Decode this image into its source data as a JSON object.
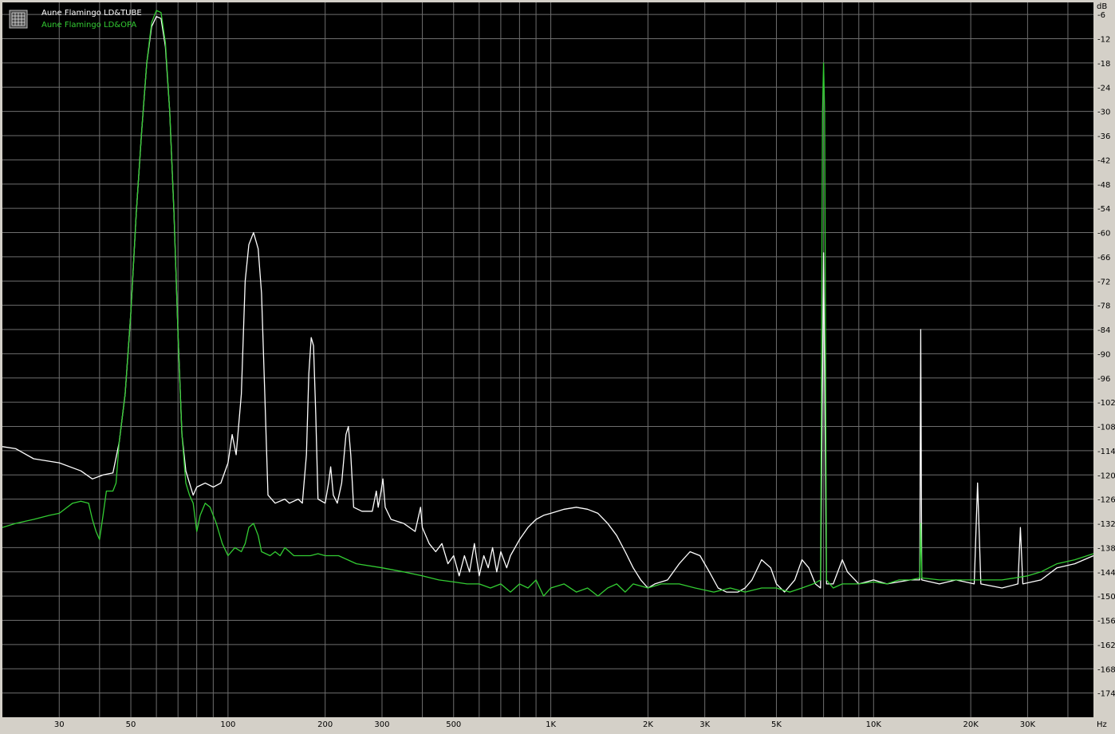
{
  "chart_data": {
    "type": "line",
    "title": "",
    "xlabel": "Hz",
    "ylabel": "dB",
    "x_scale": "log",
    "xlim": [
      20,
      48000
    ],
    "ylim": [
      -180,
      -3
    ],
    "grid": true,
    "legend_position": "top-left",
    "background": "#000000",
    "x_ticks": [
      30,
      50,
      100,
      200,
      300,
      500,
      1000,
      2000,
      3000,
      5000,
      10000,
      20000,
      30000
    ],
    "x_tick_labels": [
      "30",
      "50",
      "100",
      "200",
      "300",
      "500",
      "1K",
      "2K",
      "3K",
      "5K",
      "10K",
      "20K",
      "30K"
    ],
    "y_ticks": [
      -6,
      -12,
      -18,
      -24,
      -30,
      -36,
      -42,
      -48,
      -54,
      -60,
      -66,
      -72,
      -78,
      -84,
      -90,
      -96,
      -102,
      -108,
      -114,
      -120,
      -126,
      -132,
      -138,
      -144,
      -150,
      -156,
      -162,
      -168,
      -174
    ],
    "y_tick_labels": [
      "-6",
      "-12",
      "-18",
      "-24",
      "-30",
      "-36",
      "-42",
      "-48",
      "-54",
      "-60",
      "-66",
      "-72",
      "-78",
      "-84",
      "-90",
      "-96",
      "-102",
      "-108",
      "-114",
      "-120",
      "-126",
      "-132",
      "-138",
      "-144",
      "-150",
      "-156",
      "-162",
      "-168",
      "-174"
    ],
    "series": [
      {
        "name": "Aune Flamingo LD&TUBE",
        "color": "#ffffff",
        "points": [
          [
            20,
            -113
          ],
          [
            22,
            -113.5
          ],
          [
            25,
            -116
          ],
          [
            30,
            -117
          ],
          [
            35,
            -119
          ],
          [
            38,
            -121
          ],
          [
            41,
            -120
          ],
          [
            44,
            -119.5
          ],
          [
            46,
            -112
          ],
          [
            48,
            -100
          ],
          [
            50,
            -80
          ],
          [
            52,
            -55
          ],
          [
            54,
            -35
          ],
          [
            56,
            -18
          ],
          [
            58,
            -9
          ],
          [
            60,
            -6.5
          ],
          [
            62,
            -7
          ],
          [
            64,
            -14
          ],
          [
            66,
            -30
          ],
          [
            68,
            -55
          ],
          [
            70,
            -85
          ],
          [
            72,
            -110
          ],
          [
            74,
            -119
          ],
          [
            76,
            -122
          ],
          [
            78,
            -125
          ],
          [
            80,
            -123
          ],
          [
            85,
            -122
          ],
          [
            90,
            -123
          ],
          [
            95,
            -122
          ],
          [
            100,
            -117
          ],
          [
            103,
            -110
          ],
          [
            106,
            -115
          ],
          [
            110,
            -100
          ],
          [
            113,
            -72
          ],
          [
            116,
            -63
          ],
          [
            120,
            -60
          ],
          [
            124,
            -64
          ],
          [
            127,
            -75
          ],
          [
            130,
            -100
          ],
          [
            133,
            -125
          ],
          [
            140,
            -127
          ],
          [
            150,
            -126
          ],
          [
            155,
            -127
          ],
          [
            165,
            -126
          ],
          [
            170,
            -127
          ],
          [
            175,
            -115
          ],
          [
            178,
            -95
          ],
          [
            181,
            -86
          ],
          [
            184,
            -88
          ],
          [
            187,
            -105
          ],
          [
            190,
            -126
          ],
          [
            200,
            -127
          ],
          [
            205,
            -122
          ],
          [
            208,
            -118
          ],
          [
            212,
            -125
          ],
          [
            218,
            -127
          ],
          [
            225,
            -122
          ],
          [
            232,
            -110
          ],
          [
            236,
            -108
          ],
          [
            240,
            -115
          ],
          [
            245,
            -128
          ],
          [
            260,
            -129
          ],
          [
            280,
            -129
          ],
          [
            288,
            -124
          ],
          [
            292,
            -128
          ],
          [
            298,
            -124
          ],
          [
            302,
            -121
          ],
          [
            307,
            -128
          ],
          [
            320,
            -131
          ],
          [
            350,
            -132
          ],
          [
            380,
            -134
          ],
          [
            395,
            -128
          ],
          [
            400,
            -133
          ],
          [
            420,
            -137
          ],
          [
            440,
            -139
          ],
          [
            460,
            -137
          ],
          [
            480,
            -142
          ],
          [
            500,
            -140
          ],
          [
            520,
            -145
          ],
          [
            540,
            -140
          ],
          [
            560,
            -144
          ],
          [
            580,
            -137
          ],
          [
            600,
            -145
          ],
          [
            620,
            -140
          ],
          [
            640,
            -143
          ],
          [
            660,
            -138
          ],
          [
            680,
            -144
          ],
          [
            700,
            -139
          ],
          [
            730,
            -143
          ],
          [
            750,
            -140
          ],
          [
            800,
            -136
          ],
          [
            850,
            -133
          ],
          [
            900,
            -131
          ],
          [
            950,
            -130
          ],
          [
            1000,
            -129.5
          ],
          [
            1100,
            -128.5
          ],
          [
            1200,
            -128
          ],
          [
            1300,
            -128.5
          ],
          [
            1400,
            -129.5
          ],
          [
            1500,
            -132
          ],
          [
            1600,
            -135
          ],
          [
            1700,
            -139
          ],
          [
            1800,
            -143
          ],
          [
            1900,
            -146
          ],
          [
            2000,
            -148
          ],
          [
            2100,
            -147
          ],
          [
            2300,
            -146
          ],
          [
            2500,
            -142
          ],
          [
            2700,
            -139
          ],
          [
            2900,
            -140
          ],
          [
            3100,
            -144
          ],
          [
            3300,
            -148
          ],
          [
            3500,
            -149
          ],
          [
            3800,
            -149
          ],
          [
            4000,
            -148
          ],
          [
            4200,
            -146
          ],
          [
            4500,
            -141
          ],
          [
            4800,
            -143
          ],
          [
            5000,
            -147
          ],
          [
            5300,
            -149
          ],
          [
            5700,
            -146
          ],
          [
            6000,
            -141
          ],
          [
            6300,
            -143
          ],
          [
            6600,
            -147
          ],
          [
            6850,
            -148
          ],
          [
            6950,
            -95
          ],
          [
            7000,
            -65
          ],
          [
            7050,
            -95
          ],
          [
            7150,
            -147
          ],
          [
            7500,
            -147
          ],
          [
            8000,
            -141
          ],
          [
            8300,
            -144
          ],
          [
            9000,
            -147
          ],
          [
            10000,
            -146
          ],
          [
            11000,
            -147
          ],
          [
            13000,
            -146
          ],
          [
            13900,
            -146
          ],
          [
            14000,
            -84
          ],
          [
            14100,
            -146
          ],
          [
            16000,
            -147
          ],
          [
            18000,
            -146
          ],
          [
            20500,
            -147
          ],
          [
            21000,
            -122
          ],
          [
            21500,
            -147
          ],
          [
            25000,
            -148
          ],
          [
            28000,
            -147
          ],
          [
            28500,
            -133
          ],
          [
            29000,
            -147
          ],
          [
            33000,
            -146
          ],
          [
            37000,
            -143
          ],
          [
            42000,
            -142
          ],
          [
            48000,
            -140
          ]
        ]
      },
      {
        "name": "Aune Flamingo LD&OPA",
        "color": "#33cc33",
        "points": [
          [
            20,
            -133
          ],
          [
            22,
            -132
          ],
          [
            25,
            -131
          ],
          [
            28,
            -130
          ],
          [
            30,
            -129.5
          ],
          [
            33,
            -127
          ],
          [
            35,
            -126.5
          ],
          [
            37,
            -127
          ],
          [
            38,
            -131
          ],
          [
            39,
            -134
          ],
          [
            40,
            -136
          ],
          [
            41,
            -130
          ],
          [
            42,
            -124
          ],
          [
            44,
            -124
          ],
          [
            45,
            -122
          ],
          [
            46,
            -112
          ],
          [
            48,
            -100
          ],
          [
            50,
            -80
          ],
          [
            52,
            -55
          ],
          [
            54,
            -35
          ],
          [
            56,
            -18
          ],
          [
            58,
            -8
          ],
          [
            60,
            -5
          ],
          [
            62,
            -5.5
          ],
          [
            64,
            -13
          ],
          [
            66,
            -30
          ],
          [
            68,
            -55
          ],
          [
            70,
            -85
          ],
          [
            72,
            -110
          ],
          [
            74,
            -122
          ],
          [
            76,
            -125
          ],
          [
            78,
            -127
          ],
          [
            80,
            -134
          ],
          [
            82,
            -130
          ],
          [
            85,
            -127
          ],
          [
            88,
            -128
          ],
          [
            92,
            -132
          ],
          [
            96,
            -137
          ],
          [
            100,
            -140
          ],
          [
            105,
            -138
          ],
          [
            110,
            -139
          ],
          [
            113,
            -137
          ],
          [
            116,
            -133
          ],
          [
            120,
            -132
          ],
          [
            124,
            -135
          ],
          [
            127,
            -139
          ],
          [
            135,
            -140
          ],
          [
            140,
            -139
          ],
          [
            145,
            -140
          ],
          [
            150,
            -138
          ],
          [
            160,
            -140
          ],
          [
            170,
            -140
          ],
          [
            180,
            -140
          ],
          [
            190,
            -139.5
          ],
          [
            200,
            -140
          ],
          [
            220,
            -140
          ],
          [
            250,
            -142
          ],
          [
            300,
            -143
          ],
          [
            350,
            -144
          ],
          [
            400,
            -145
          ],
          [
            450,
            -146
          ],
          [
            500,
            -146.5
          ],
          [
            550,
            -147
          ],
          [
            600,
            -147
          ],
          [
            650,
            -148
          ],
          [
            700,
            -147
          ],
          [
            750,
            -149
          ],
          [
            800,
            -147
          ],
          [
            850,
            -148
          ],
          [
            900,
            -146
          ],
          [
            950,
            -150
          ],
          [
            1000,
            -148
          ],
          [
            1100,
            -147
          ],
          [
            1200,
            -149
          ],
          [
            1300,
            -148
          ],
          [
            1400,
            -150
          ],
          [
            1500,
            -148
          ],
          [
            1600,
            -147
          ],
          [
            1700,
            -149
          ],
          [
            1800,
            -147
          ],
          [
            2000,
            -148
          ],
          [
            2200,
            -147
          ],
          [
            2500,
            -147
          ],
          [
            2800,
            -148
          ],
          [
            3200,
            -149
          ],
          [
            3600,
            -148
          ],
          [
            4000,
            -149
          ],
          [
            4500,
            -148
          ],
          [
            5000,
            -148
          ],
          [
            5500,
            -149
          ],
          [
            6000,
            -148
          ],
          [
            6500,
            -147
          ],
          [
            6850,
            -146
          ],
          [
            6950,
            -30
          ],
          [
            7000,
            -18
          ],
          [
            7050,
            -30
          ],
          [
            7150,
            -146
          ],
          [
            7500,
            -148
          ],
          [
            8000,
            -147
          ],
          [
            9000,
            -147
          ],
          [
            10000,
            -146.5
          ],
          [
            11000,
            -147
          ],
          [
            12000,
            -146
          ],
          [
            13000,
            -146
          ],
          [
            13900,
            -145.5
          ],
          [
            14000,
            -132
          ],
          [
            14100,
            -145.5
          ],
          [
            16000,
            -146
          ],
          [
            18000,
            -146
          ],
          [
            20000,
            -146
          ],
          [
            25000,
            -146
          ],
          [
            30000,
            -145
          ],
          [
            33000,
            -144
          ],
          [
            37000,
            -142
          ],
          [
            42000,
            -141
          ],
          [
            48000,
            -139.5
          ]
        ]
      }
    ]
  }
}
